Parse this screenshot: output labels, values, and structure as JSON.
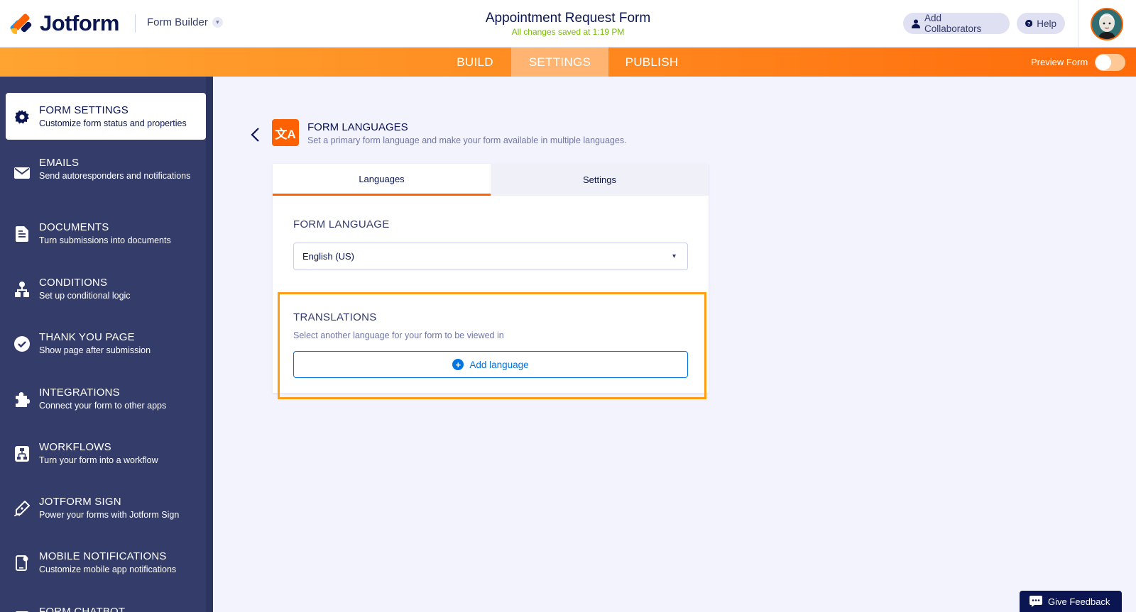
{
  "header": {
    "logo_text": "Jotform",
    "builder_label": "Form Builder",
    "form_title": "Appointment Request Form",
    "save_status": "All changes saved at 1:19 PM",
    "collaborators_label": "Add Collaborators",
    "help_label": "Help"
  },
  "nav": {
    "build": "BUILD",
    "settings": "SETTINGS",
    "publish": "PUBLISH",
    "preview_label": "Preview Form",
    "preview_enabled": false
  },
  "sidebar": {
    "items": [
      {
        "title": "FORM SETTINGS",
        "desc": "Customize form status and properties",
        "icon": "gear-icon",
        "active": true
      },
      {
        "title": "EMAILS",
        "desc": "Send autoresponders and notifications",
        "icon": "envelope-icon",
        "active": false
      },
      {
        "title": "DOCUMENTS",
        "desc": "Turn submissions into documents",
        "icon": "document-icon",
        "active": false
      },
      {
        "title": "CONDITIONS",
        "desc": "Set up conditional logic",
        "icon": "hierarchy-icon",
        "active": false
      },
      {
        "title": "THANK YOU PAGE",
        "desc": "Show page after submission",
        "icon": "check-circle-icon",
        "active": false
      },
      {
        "title": "INTEGRATIONS",
        "desc": "Connect your form to other apps",
        "icon": "puzzle-icon",
        "active": false
      },
      {
        "title": "WORKFLOWS",
        "desc": "Turn your form into a workflow",
        "icon": "workflow-icon",
        "active": false
      },
      {
        "title": "JOTFORM SIGN",
        "desc": "Power your forms with Jotform Sign",
        "icon": "pen-icon",
        "active": false
      },
      {
        "title": "MOBILE NOTIFICATIONS",
        "desc": "Customize mobile app notifications",
        "icon": "mobile-icon",
        "active": false
      },
      {
        "title": "FORM CHATBOT",
        "desc": "",
        "icon": "chat-icon",
        "active": false
      }
    ]
  },
  "main": {
    "section_title": "FORM LANGUAGES",
    "section_desc": "Set a primary form language and make your form available in multiple languages.",
    "tabs": [
      "Languages",
      "Settings"
    ],
    "form_language_label": "FORM LANGUAGE",
    "form_language_value": "English (US)",
    "translations_label": "TRANSLATIONS",
    "translations_desc": "Select another language for your form to be viewed in",
    "add_language_label": "Add language"
  },
  "feedback_label": "Give Feedback",
  "colors": {
    "brand_orange": "#ff6100",
    "navy": "#0a1551",
    "sidebar_bg": "#343c6a",
    "link_blue": "#0075e3",
    "highlight": "#ff9d16",
    "saved_green": "#78bb07"
  }
}
